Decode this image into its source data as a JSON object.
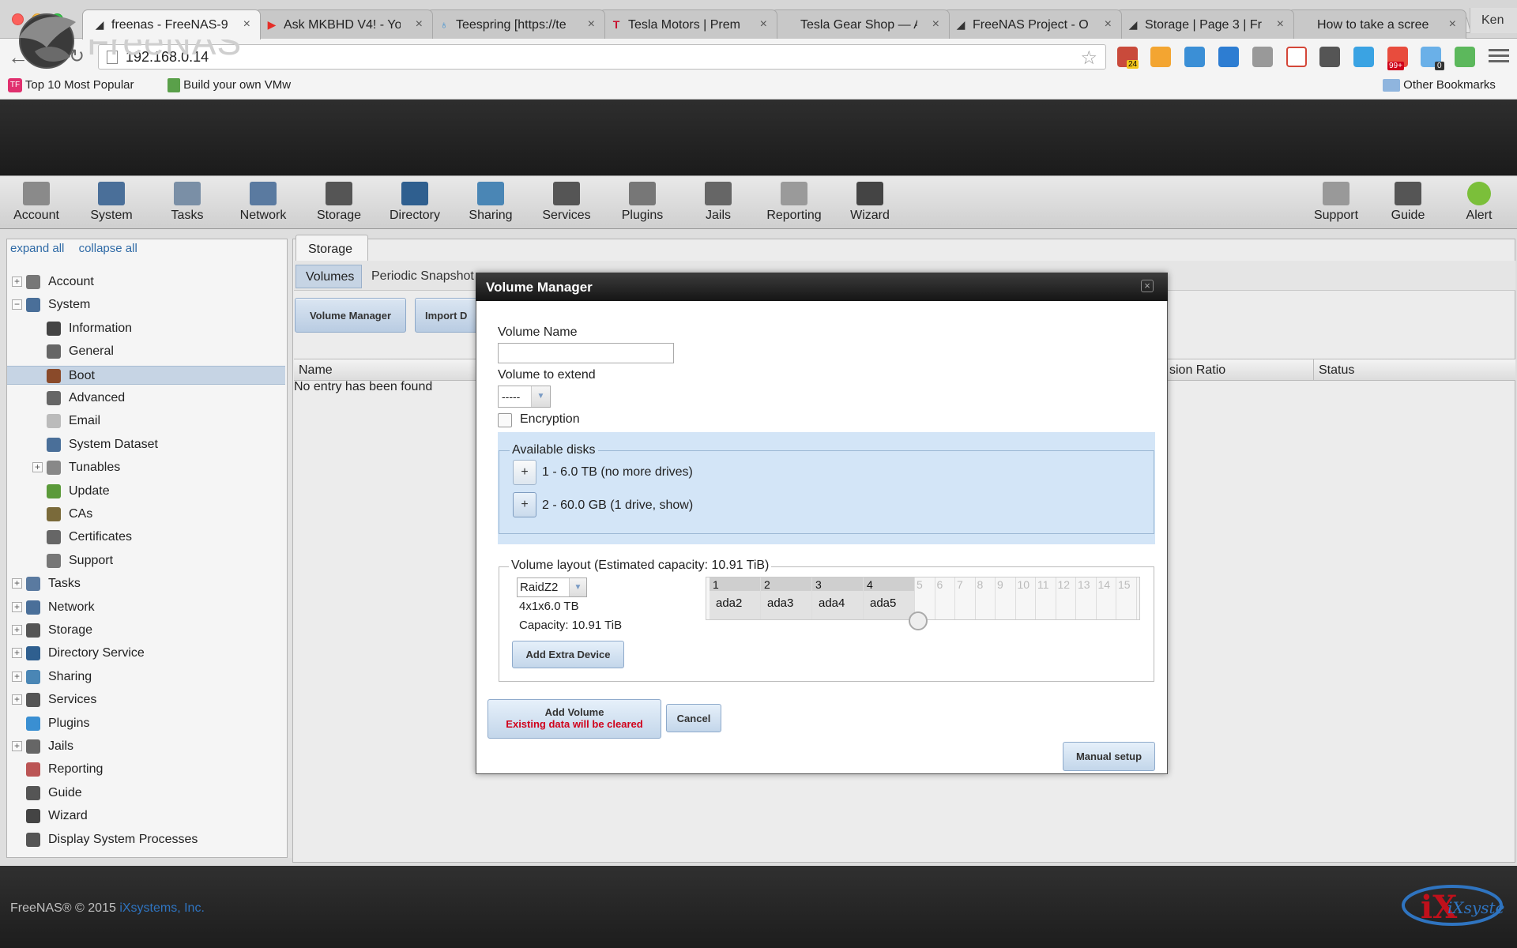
{
  "browser": {
    "tabs": [
      {
        "title": "freenas - FreeNAS-9",
        "active": true,
        "favicon": "shark-fin-icon"
      },
      {
        "title": "Ask MKBHD V4! - Yo",
        "favicon": "youtube-icon"
      },
      {
        "title": "Teespring [https://te",
        "favicon": "teespring-icon"
      },
      {
        "title": "Tesla Motors | Prem",
        "favicon": "tesla-icon"
      },
      {
        "title": "Tesla Gear Shop — A",
        "favicon": "tesla-gear-icon"
      },
      {
        "title": "FreeNAS Project - O",
        "favicon": "shark-fin-icon"
      },
      {
        "title": "Storage | Page 3 | Fr",
        "favicon": "shark-fin-icon"
      },
      {
        "title": "How to take a scree",
        "favicon": "apple-icon"
      }
    ],
    "profile": "Ken",
    "url": "192.168.0.14",
    "extension_badges": [
      "24",
      "99+",
      "0"
    ],
    "bookmarks": [
      {
        "label": "Top 10 Most Popular",
        "icon": "tf-icon"
      },
      {
        "label": "Build your own VMw",
        "icon": "doc-icon"
      }
    ],
    "other_bookmarks": "Other Bookmarks"
  },
  "app": {
    "logo": "FreeNAS",
    "toolbar_left": [
      "Account",
      "System",
      "Tasks",
      "Network",
      "Storage",
      "Directory",
      "Sharing",
      "Services",
      "Plugins",
      "Jails",
      "Reporting",
      "Wizard"
    ],
    "toolbar_right": [
      "Support",
      "Guide",
      "Alert"
    ],
    "tree_links": {
      "expand": "expand all",
      "collapse": "collapse all"
    },
    "tree": [
      {
        "label": "Account",
        "level": 0,
        "toggle": "+"
      },
      {
        "label": "System",
        "level": 0,
        "toggle": "−"
      },
      {
        "label": "Information",
        "level": 1
      },
      {
        "label": "General",
        "level": 1
      },
      {
        "label": "Boot",
        "level": 1,
        "selected": true
      },
      {
        "label": "Advanced",
        "level": 1
      },
      {
        "label": "Email",
        "level": 1
      },
      {
        "label": "System Dataset",
        "level": 1
      },
      {
        "label": "Tunables",
        "level": 1,
        "toggle": "+"
      },
      {
        "label": "Update",
        "level": 1
      },
      {
        "label": "CAs",
        "level": 1
      },
      {
        "label": "Certificates",
        "level": 1
      },
      {
        "label": "Support",
        "level": 1
      },
      {
        "label": "Tasks",
        "level": 0,
        "toggle": "+"
      },
      {
        "label": "Network",
        "level": 0,
        "toggle": "+"
      },
      {
        "label": "Storage",
        "level": 0,
        "toggle": "+"
      },
      {
        "label": "Directory Service",
        "level": 0,
        "toggle": "+"
      },
      {
        "label": "Sharing",
        "level": 0,
        "toggle": "+"
      },
      {
        "label": "Services",
        "level": 0,
        "toggle": "+"
      },
      {
        "label": "Plugins",
        "level": 0
      },
      {
        "label": "Jails",
        "level": 0,
        "toggle": "+"
      },
      {
        "label": "Reporting",
        "level": 0
      },
      {
        "label": "Guide",
        "level": 0
      },
      {
        "label": "Wizard",
        "level": 0
      },
      {
        "label": "Display System Processes",
        "level": 0
      }
    ],
    "storage_tab": "Storage",
    "subtabs": {
      "volumes": "Volumes",
      "periodic": "Periodic Snapshot"
    },
    "buttons": {
      "volume_manager": "Volume Manager",
      "import": "Import D"
    },
    "grid_headers": {
      "name": "Name",
      "compression": "sion Ratio",
      "status": "Status"
    },
    "no_entry": "No entry has been found",
    "footer": {
      "copyright": "FreeNAS® © 2015",
      "company": "iXsystems, Inc.",
      "logo": "iXsystems"
    }
  },
  "dialog": {
    "title": "Volume Manager",
    "volume_name_label": "Volume Name",
    "volume_name_value": "",
    "extend_label": "Volume to extend",
    "extend_value": "-----",
    "encryption_label": "Encryption",
    "encryption_checked": false,
    "available_disks_label": "Available disks",
    "disk_groups": [
      "1 - 6.0 TB (no more drives)",
      "2 - 60.0 GB (1 drive, show)"
    ],
    "layout_label": "Volume layout (Estimated capacity: 10.91 TiB)",
    "layout_type": "RaidZ2",
    "layout_config": "4x1x6.0 TB",
    "capacity": "Capacity: 10.91 TiB",
    "add_extra_device": "Add Extra Device",
    "grid_columns": [
      "1",
      "2",
      "3",
      "4",
      "5",
      "6",
      "7",
      "8",
      "9",
      "10",
      "11",
      "12",
      "13",
      "14",
      "15"
    ],
    "assigned_disks": [
      "ada2",
      "ada3",
      "ada4",
      "ada5"
    ],
    "add_volume": "Add Volume",
    "add_volume_warning": "Existing data will be cleared",
    "cancel": "Cancel",
    "manual_setup": "Manual setup"
  },
  "colors": {
    "accent": "#2f6aa6",
    "warning": "#d0021b",
    "selection": "#c6d4e4",
    "disk_area": "#d3e5f7"
  }
}
